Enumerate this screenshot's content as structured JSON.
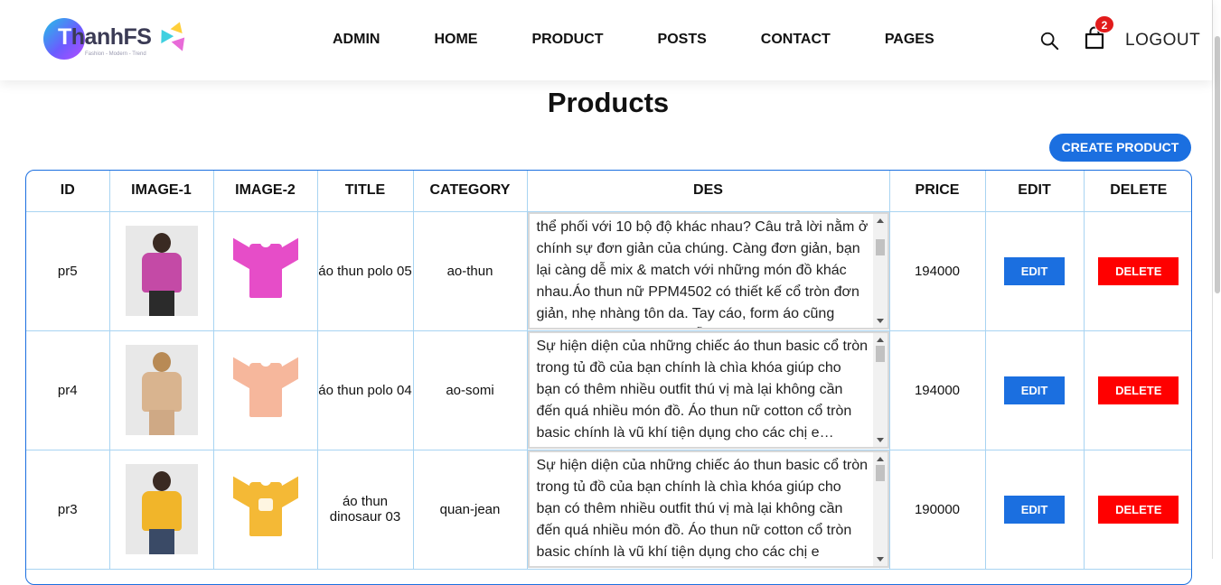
{
  "header": {
    "logo_text_first": "T",
    "logo_text_rest": "hanhFS",
    "logo_tagline": "Fashion - Modern - Trend",
    "nav": [
      "ADMIN",
      "HOME",
      "PRODUCT",
      "POSTS",
      "CONTACT",
      "PAGES"
    ],
    "cart_count": "2",
    "logout_label": "LOGOUT"
  },
  "page": {
    "title": "Products",
    "create_label": "CREATE PRODUCT"
  },
  "table": {
    "headers": [
      "ID",
      "IMAGE-1",
      "IMAGE-2",
      "TITLE",
      "CATEGORY",
      "DES",
      "PRICE",
      "EDIT",
      "DELETE"
    ],
    "rows": [
      {
        "id": "pr5",
        "title": "áo thun polo 05",
        "category": "ao-thun",
        "des": "thể phối với 10 bộ độ khác nhau? Câu trả lời nằm ở chính sự đơn giản của chúng. Càng đơn giản, bạn lại càng dễ mix & match với những món đồ khác nhau.Áo thun nữ PPM4502 có thiết kế cổ tròn đơn giản, nhẹ nhàng tôn da. Tay cáo, form áo cũng không hề cầu kì mà rất dễ mặc với kiểu thân hình",
        "price": "194000",
        "edit": "EDIT",
        "delete": "DELETE",
        "shirt_color": "#e64dc8",
        "model_color": "#c44aa6"
      },
      {
        "id": "pr4",
        "title": "áo thun polo 04",
        "category": "ao-somi",
        "des": "Sự hiện diện của những chiếc áo thun basic cổ tròn trong tủ đồ của bạn chính là chìa khóa giúp cho bạn có thêm nhiều outfit thú vị mà lại không cần đến quá nhiều món đồ. Áo thun nữ cotton cổ tròn basic chính là vũ khí tiện dụng cho các chị e…",
        "price": "194000",
        "edit": "EDIT",
        "delete": "DELETE",
        "shirt_color": "#f6b79c",
        "model_color": "#d9b48f"
      },
      {
        "id": "pr3",
        "title": "áo thun dinosaur 03",
        "category": "quan-jean",
        "des": "Sự hiện diện của những chiếc áo thun basic cổ tròn trong tủ đồ của bạn chính là chìa khóa giúp cho bạn có thêm nhiều outfit thú vị mà lại không cần đến quá nhiều món đồ. Áo thun nữ cotton cổ tròn basic chính là vũ khí tiện dụng cho các chị e",
        "price": "190000",
        "edit": "EDIT",
        "delete": "DELETE",
        "shirt_color": "#f4b936",
        "model_color": "#f1b52a"
      }
    ]
  }
}
